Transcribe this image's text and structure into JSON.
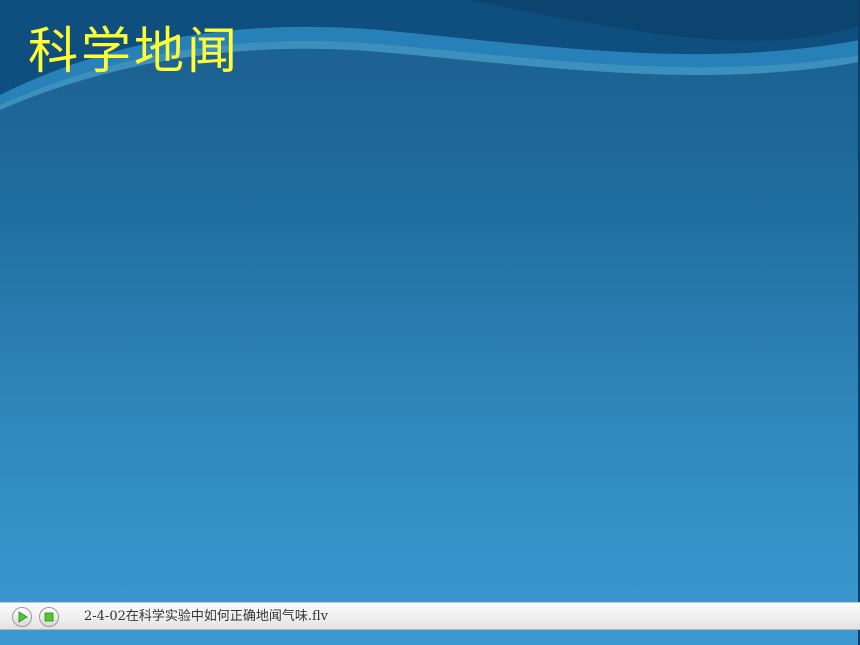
{
  "slide": {
    "title": "科学地闻",
    "title_color": "#ffff33",
    "background_top": "#1a5e8e",
    "background_bottom": "#3c9ad0"
  },
  "player": {
    "play_icon": "play-icon",
    "stop_icon": "stop-icon",
    "file_name": "2-4-02在科学实验中如何正确地闻气味.flv",
    "accent_color": "#4fc832"
  }
}
